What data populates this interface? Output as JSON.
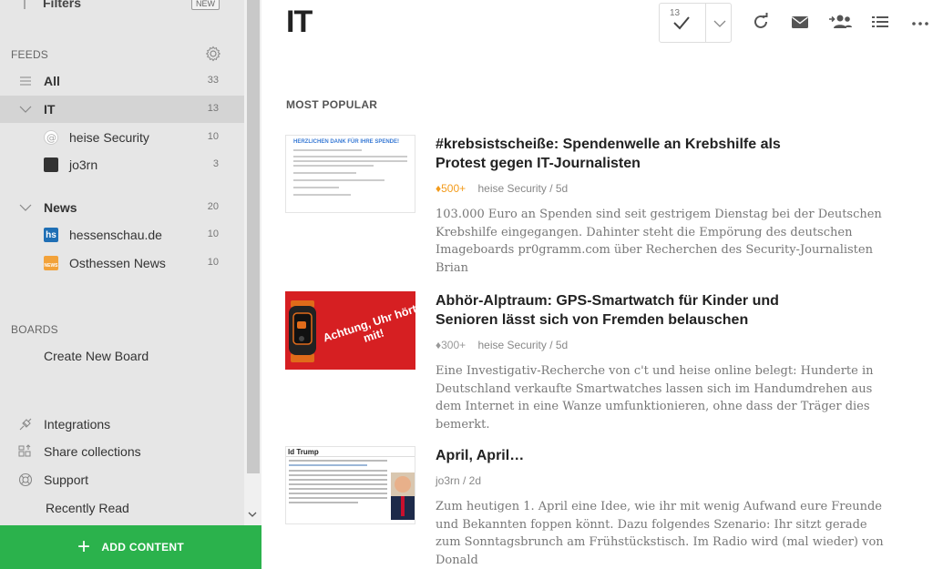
{
  "sidebar": {
    "filters_label": "Filters",
    "new_badge": "NEW",
    "feeds_label": "FEEDS",
    "all": {
      "label": "All",
      "count": "33"
    },
    "it": {
      "label": "IT",
      "count": "13"
    },
    "it_feeds": [
      {
        "label": "heise Security",
        "count": "10"
      },
      {
        "label": "jo3rn",
        "count": "3"
      }
    ],
    "news": {
      "label": "News",
      "count": "20"
    },
    "news_feeds": [
      {
        "label": "hessenschau.de",
        "count": "10",
        "icon_text": "hs"
      },
      {
        "label": "Osthessen News",
        "count": "10",
        "icon_text": "NEWS"
      }
    ],
    "boards_label": "BOARDS",
    "create_board": "Create New Board",
    "integrations": "Integrations",
    "share_collections": "Share collections",
    "support": "Support",
    "recently_read": "Recently Read",
    "add_content": "ADD CONTENT"
  },
  "main": {
    "title": "IT",
    "unread_count": "13",
    "section_label": "MOST POPULAR",
    "articles": [
      {
        "title": "#krebsistscheiße: Spendenwelle an Krebshilfe als Protest gegen IT-Journalisten",
        "popularity": "500+",
        "meta": "heise Security / 5d",
        "summary": "103.000 Euro an Spenden sind seit gestrigem Dienstag bei der Deutschen Krebshilfe eingegangen. Dahinter steht die Empörung des deutschen Imageboards pr0gramm.com über Recherchen des Security-Journalisten Brian",
        "thumb_heading": "HERZLICHEN DANK FÜR IHRE SPENDE!"
      },
      {
        "title": "Abhör-Alptraum: GPS-Smartwatch für Kinder und Senioren lässt sich von Fremden belauschen",
        "popularity": "300+",
        "meta": "heise Security / 5d",
        "summary": "Eine Investigativ-Recherche von c't und heise online belegt: Hunderte in Deutschland verkaufte Smartwatches lassen sich im Handumdrehen aus dem Internet in eine Wanze umfunktionieren, ohne dass der Träger dies bemerkt.",
        "thumb_banner": "Achtung, Uhr hört mit!"
      },
      {
        "title": "April, April…",
        "meta": "jo3rn / 2d",
        "summary": "Zum heutigen 1. April eine Idee, wie ihr mit wenig Aufwand eure Freunde und Bekannten foppen könnt. Dazu folgendes Szenario: Ihr sitzt gerade zum Sonntagsbrunch am Frühstückstisch. Im Radio wird (mal wieder) von Donald",
        "thumb_heading": "ld Trump"
      }
    ]
  },
  "colors": {
    "accent_green": "#2bb24c",
    "popularity_orange": "#f39b1b",
    "sidebar_bg": "#e6e6e6",
    "selected_bg": "#d4d4d4"
  }
}
